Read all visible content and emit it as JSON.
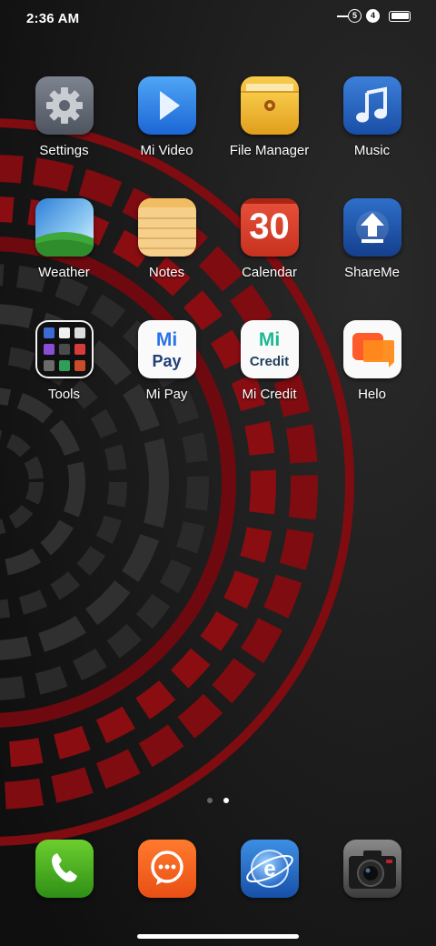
{
  "status_bar": {
    "time": "2:36 AM",
    "sim1": "5",
    "sim2": "4",
    "battery_level": 1.0
  },
  "apps": [
    {
      "label": "Settings",
      "icon": "gear-icon"
    },
    {
      "label": "Mi Video",
      "icon": "play-icon"
    },
    {
      "label": "File Manager",
      "icon": "folder-icon"
    },
    {
      "label": "Music",
      "icon": "music-note-icon"
    },
    {
      "label": "Weather",
      "icon": "weather-landscape-icon"
    },
    {
      "label": "Notes",
      "icon": "notepad-icon"
    },
    {
      "label": "Calendar",
      "icon": "calendar-icon",
      "day": "30"
    },
    {
      "label": "ShareMe",
      "icon": "upload-arrow-icon"
    },
    {
      "label": "Tools",
      "icon": "tools-folder-icon"
    },
    {
      "label": "Mi Pay",
      "icon": "mi-pay-icon",
      "logo_top": "Mi",
      "logo_bottom": "Pay"
    },
    {
      "label": "Mi Credit",
      "icon": "mi-credit-icon",
      "logo_top": "Mi",
      "logo_bottom": "Credit"
    },
    {
      "label": "Helo",
      "icon": "helo-chat-icon"
    }
  ],
  "dock": [
    {
      "icon": "phone-icon"
    },
    {
      "icon": "messaging-icon"
    },
    {
      "icon": "browser-globe-icon"
    },
    {
      "icon": "camera-icon"
    }
  ],
  "page_indicator": {
    "pages": 2,
    "current": 2
  },
  "colors": {
    "wallpaper_red": "#8a0d12",
    "wallpaper_dark": "#141414",
    "mi_green": "#1db894",
    "mi_blue": "#2a73e8"
  }
}
